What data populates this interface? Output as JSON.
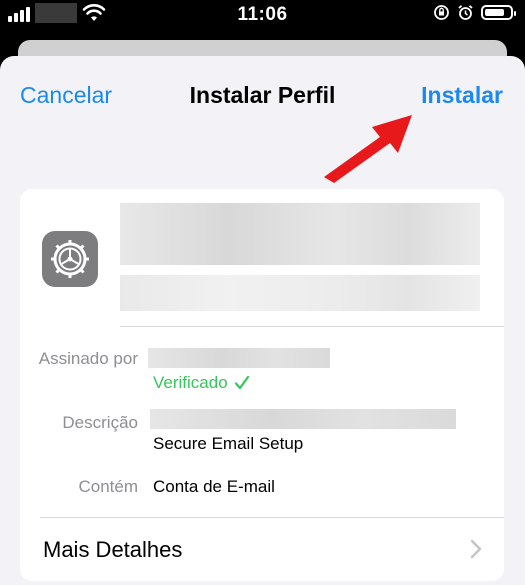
{
  "status_bar": {
    "time": "11:06",
    "battery_level": 0.8
  },
  "nav": {
    "cancel": "Cancelar",
    "title": "Instalar Perfil",
    "install": "Instalar"
  },
  "profile": {
    "signed_by_label": "Assinado por",
    "verified_text": "Verificado",
    "verified_color": "#34c759",
    "description_label": "Descrição",
    "description_value": "Secure Email Setup",
    "contains_label": "Contém",
    "contains_value": "Conta de E-mail",
    "more_details": "Mais Detalhes"
  },
  "colors": {
    "accent": "#1a8af0",
    "arrow": "#e8191a"
  },
  "icons": [
    "cellular-signal-icon",
    "wifi-icon",
    "screen-rotation-lock-icon",
    "alarm-icon",
    "battery-icon",
    "settings-gear-icon",
    "checkmark-icon",
    "chevron-right-icon",
    "red-arrow-annotation"
  ]
}
